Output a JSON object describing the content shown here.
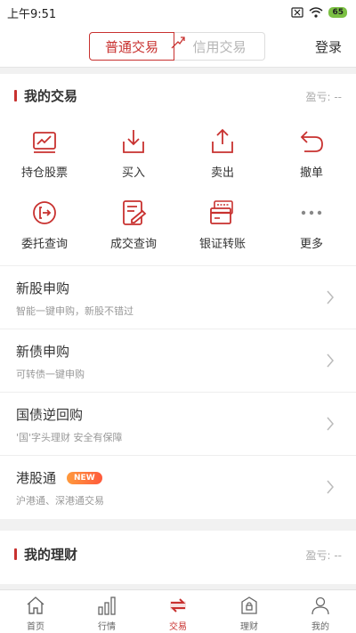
{
  "status": {
    "time": "上午9:51",
    "battery": "65"
  },
  "header": {
    "tab_active": "普通交易",
    "tab_inactive": "信用交易",
    "login": "登录"
  },
  "my_trade": {
    "title": "我的交易",
    "pnl": "盈亏: --",
    "grid": [
      {
        "label": "持仓股票",
        "icon": "holdings-chart-icon"
      },
      {
        "label": "买入",
        "icon": "download-tray-icon"
      },
      {
        "label": "卖出",
        "icon": "upload-tray-icon"
      },
      {
        "label": "撤单",
        "icon": "undo-arrow-icon"
      },
      {
        "label": "委托查询",
        "icon": "exit-circle-icon"
      },
      {
        "label": "成交查询",
        "icon": "edit-document-icon"
      },
      {
        "label": "银证转账",
        "icon": "bank-card-icon"
      },
      {
        "label": "更多",
        "icon": "more-dots-icon"
      }
    ],
    "list": [
      {
        "title": "新股申购",
        "sub": "智能一键申购，新股不错过"
      },
      {
        "title": "新债申购",
        "sub": "可转债一键申购"
      },
      {
        "title": "国债逆回购",
        "sub": "'国'字头理财 安全有保障"
      },
      {
        "title": "港股通",
        "sub": "沪港通、深港通交易",
        "badge": "NEW"
      }
    ]
  },
  "my_finance": {
    "title": "我的理财",
    "pnl": "盈亏: --"
  },
  "tabbar": [
    {
      "label": "首页",
      "icon": "home-icon"
    },
    {
      "label": "行情",
      "icon": "market-bars-icon"
    },
    {
      "label": "交易",
      "icon": "trade-exchange-icon",
      "active": true
    },
    {
      "label": "理财",
      "icon": "wallet-lock-icon"
    },
    {
      "label": "我的",
      "icon": "user-icon"
    }
  ],
  "colors": {
    "accent": "#c8312f",
    "background": "#f1f1f1",
    "badge": "#ff7a3c"
  }
}
